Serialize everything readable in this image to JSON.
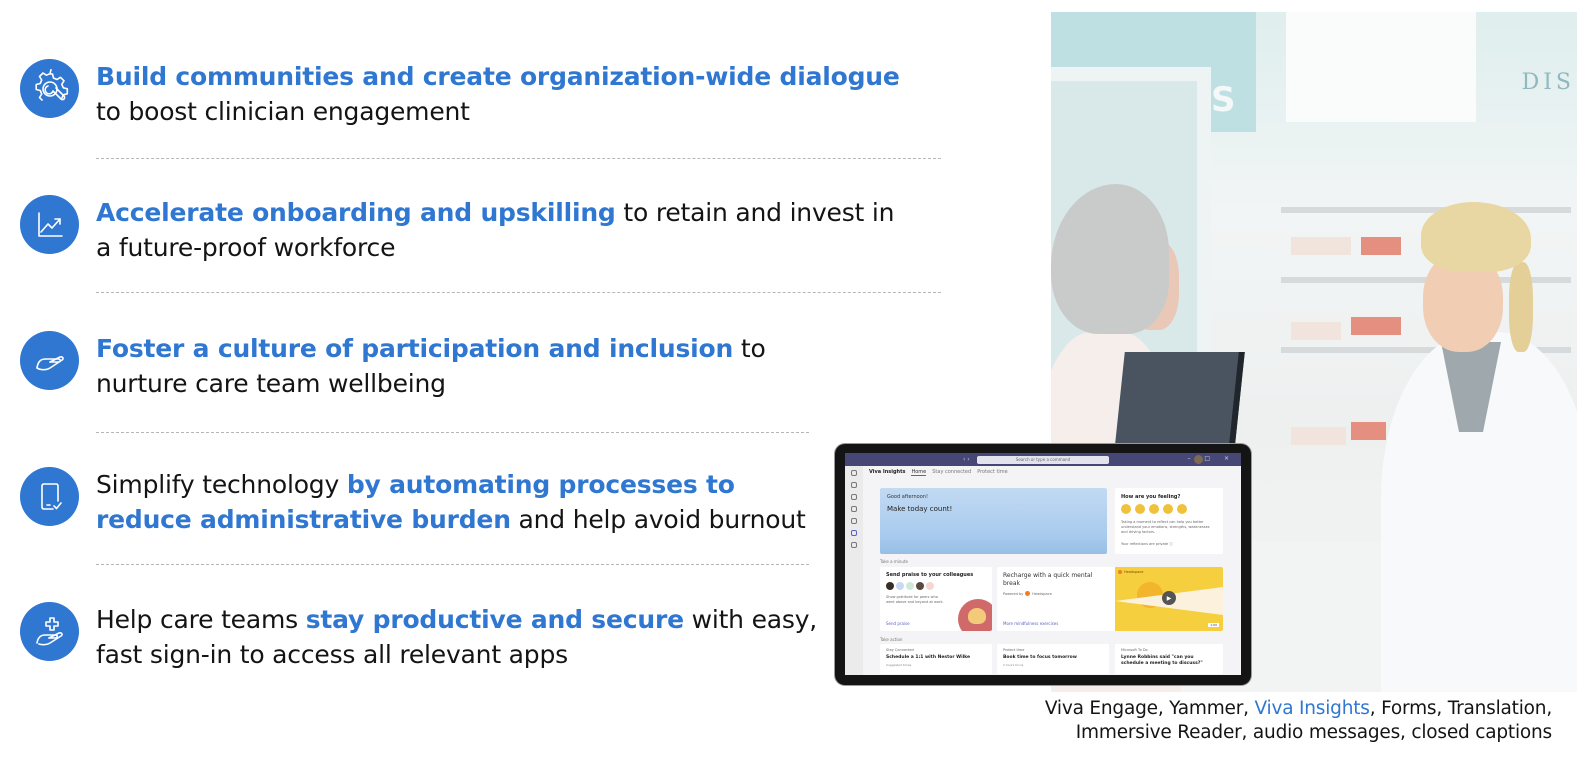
{
  "colors": {
    "accent": "#2f77d1",
    "text": "#141414",
    "divider": "#b7b7b7"
  },
  "features": [
    {
      "icon": "gear-wrench-icon",
      "parts": [
        {
          "text": "Build communities and create organization-wide dialogue",
          "highlight": true
        },
        {
          "text": "to boost clinician engagement",
          "highlight": false,
          "line_break_before": true
        }
      ]
    },
    {
      "icon": "trending-up-chart-icon",
      "parts": [
        {
          "text": "Accelerate onboarding and upskilling",
          "highlight": true
        },
        {
          "text": " to retain and invest in",
          "highlight": false
        },
        {
          "text": "a future-proof workforce",
          "highlight": false,
          "line_break_before": true
        }
      ]
    },
    {
      "icon": "open-hand-icon",
      "parts": [
        {
          "text": "Foster a culture of participation and inclusion",
          "highlight": true
        },
        {
          "text": " to",
          "highlight": false
        },
        {
          "text": "nurture care team wellbeing",
          "highlight": false,
          "line_break_before": true
        }
      ]
    },
    {
      "icon": "mobile-check-icon",
      "parts": [
        {
          "text": "Simplify technology ",
          "highlight": false
        },
        {
          "text": "by automating processes to",
          "highlight": true
        },
        {
          "text": "reduce administrative burden",
          "highlight": true,
          "line_break_before": true
        },
        {
          "text": " and help avoid burnout",
          "highlight": false
        }
      ]
    },
    {
      "icon": "hand-medical-cross-icon",
      "parts": [
        {
          "text": "Help care teams ",
          "highlight": false
        },
        {
          "text": "stay productive and secure",
          "highlight": true
        },
        {
          "text": " with easy,",
          "highlight": false
        },
        {
          "text": "fast sign-in to access all relevant apps",
          "highlight": false,
          "line_break_before": true
        }
      ]
    }
  ],
  "photo": {
    "subject": "pharmacist-serving-customer-photo",
    "sign_text": "DIS",
    "sign_letter": "S"
  },
  "tablet": {
    "search_placeholder": "Search or type a command",
    "nav_arrows": "‹ ›",
    "window_controls": "– □ ×",
    "app_name": "Viva Insights",
    "tabs": [
      "Home",
      "Stay connected",
      "Protect time"
    ],
    "hero": {
      "greeting": "Good afternoon!",
      "headline": "Make today count!"
    },
    "feeling": {
      "title": "How are you feeling?",
      "description": "Taking a moment to reflect can help you better understand your emotions, strengths, weaknesses and driving factors.",
      "privacy": "Your reflections are private ⓘ"
    },
    "section_take_minute": "Take a minute",
    "praise": {
      "title": "Send praise to your colleagues",
      "description": "Show gratitude for peers who went above and beyond at work.",
      "link": "Send praise",
      "avatar_colors": [
        "#3a2d25",
        "#c9d9f2",
        "#cfe9d8",
        "#5a4a3e",
        "#f6d6d0"
      ]
    },
    "recharge": {
      "title": "Recharge with a quick mental break",
      "powered_by": "Powered by",
      "brand": "Headspace",
      "link": "More mindfulness exercises",
      "video_duration": "1:00"
    },
    "section_take_action": "Take action",
    "actions": [
      {
        "kind": "Stay Connected",
        "title": "Schedule a 1:1 with Nestor Wilke",
        "sub": "Suggested times"
      },
      {
        "kind": "Protect time",
        "title": "Book time to focus tomorrow",
        "sub": "2 hours focus"
      },
      {
        "kind": "Microsoft To Do",
        "title": "Lynne Robbins said \"can you schedule a meeting to discuss?\"",
        "sub": ""
      }
    ]
  },
  "caption": {
    "line1_before": "Viva Engage, Yammer, ",
    "line1_highlight": "Viva Insights",
    "line1_after": ", Forms, Translation,",
    "line2": "Immersive Reader, audio messages, closed captions"
  }
}
